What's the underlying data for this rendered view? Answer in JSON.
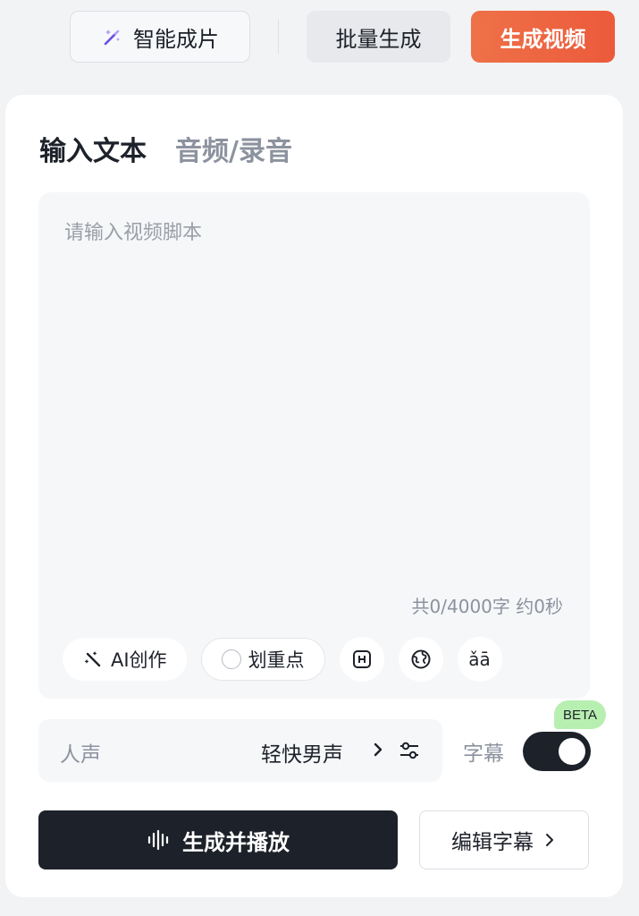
{
  "toolbar": {
    "smart_label": "智能成片",
    "smart_icon": "magic-wand-icon",
    "batch_label": "批量生成",
    "generate_label": "生成视频",
    "generate_color": "#ec5a3b"
  },
  "tabs": [
    {
      "label": "输入文本",
      "active": true
    },
    {
      "label": "音频/录音",
      "active": false
    }
  ],
  "editor": {
    "placeholder": "请输入视频脚本",
    "counter": "共0/4000字 约0秒"
  },
  "tools": {
    "ai_label": "AI创作",
    "ai_icon": "magic-wand-icon",
    "highlight_label": "划重点",
    "highlight_icon": "circle-icon",
    "pause_icon": "bracket-h-icon",
    "globe_icon": "globe-icon",
    "pinyin_label": "ǎā"
  },
  "voice": {
    "label": "人声",
    "value": "轻快男声",
    "chevron_icon": "chevron-right-icon",
    "settings_icon": "sliders-icon"
  },
  "subtitle": {
    "label": "字幕",
    "enabled": true
  },
  "actions": {
    "play_label": "生成并播放",
    "play_icon": "waveform-icon",
    "edit_label": "编辑字幕",
    "badge": "BETA"
  }
}
